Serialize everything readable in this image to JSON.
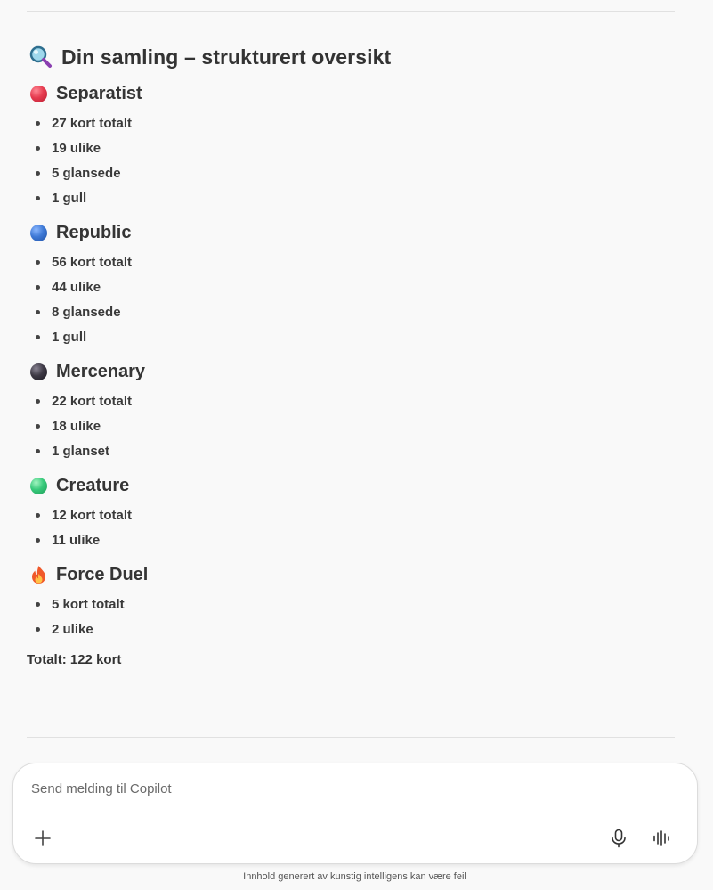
{
  "title": "Din samling – strukturert oversikt",
  "title_icon": "magnifying-glass-icon",
  "sections": [
    {
      "name": "Separatist",
      "icon": "red-circle-icon",
      "color": "#e63b4f",
      "items": [
        "27 kort totalt",
        "19 ulike",
        "5 glansede",
        "1 gull"
      ]
    },
    {
      "name": "Republic",
      "icon": "blue-circle-icon",
      "color": "#3e79d6",
      "items": [
        "56 kort totalt",
        "44 ulike",
        "8 glansede",
        "1 gull"
      ]
    },
    {
      "name": "Mercenary",
      "icon": "black-circle-icon",
      "color": "#3d3945",
      "items": [
        "22 kort totalt",
        "18 ulike",
        "1 glanset"
      ]
    },
    {
      "name": "Creature",
      "icon": "green-circle-icon",
      "color": "#37c97a",
      "items": [
        "12 kort totalt",
        "11 ulike"
      ]
    },
    {
      "name": "Force Duel",
      "icon": "fire-icon",
      "color": "#f0592a",
      "items": [
        "5 kort totalt",
        "2 ulike"
      ]
    }
  ],
  "total": "Totalt: 122 kort",
  "composer": {
    "placeholder": "Send melding til Copilot",
    "add_icon": "plus-icon",
    "mic_icon": "microphone-icon",
    "voice_icon": "voice-wave-icon"
  },
  "disclaimer": "Innhold generert av kunstig intelligens kan være feil"
}
